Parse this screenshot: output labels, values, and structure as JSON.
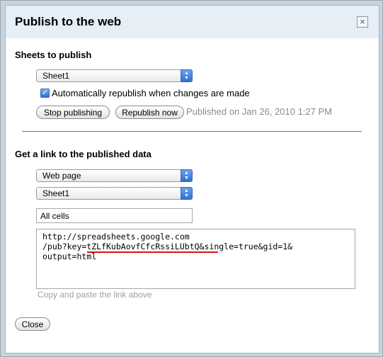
{
  "dialog": {
    "title": "Publish to the web",
    "close_glyph": "×",
    "close_icon": "close-icon"
  },
  "publish_section": {
    "heading": "Sheets to publish",
    "sheet_select": {
      "value": "Sheet1"
    },
    "auto_republish": {
      "label": "Automatically republish when changes are made",
      "checked": true
    },
    "stop_label": "Stop publishing",
    "republish_label": "Republish now",
    "status": "Published on Jan 26, 2010 1:27 PM"
  },
  "link_section": {
    "heading": "Get a link to the published data",
    "format_select": {
      "value": "Web page"
    },
    "sheet_select": {
      "value": "Sheet1"
    },
    "range_field": {
      "value": "All cells"
    },
    "link_text": "http://spreadsheets.google.com\n/pub?key=tZLfKubAovfCfcRssiLUbtQ&single=true&gid=1&\noutput=html",
    "hint": "Copy and paste the link above"
  },
  "footer": {
    "close_label": "Close"
  },
  "colors": {
    "titlebar": "#e6eef6",
    "select_arrow": "#2f6fd8",
    "key_underline": "#d01818",
    "status_text": "#8a8a8a"
  }
}
